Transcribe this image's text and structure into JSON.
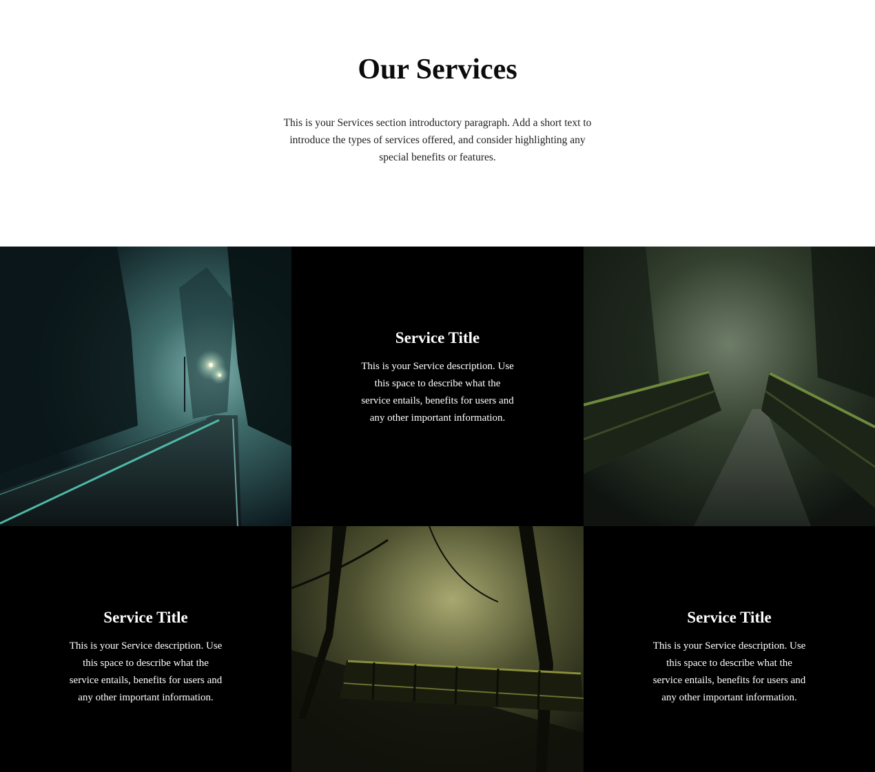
{
  "intro": {
    "title": "Our Services",
    "paragraph": "This is your Services section introductory paragraph. Add a short text to introduce the types of services offered, and consider highlighting any special benefits or features."
  },
  "services": [
    {
      "title": "Service Title",
      "description": "This is your Service description. Use this space to describe what the service entails, benefits for users and any other important information."
    },
    {
      "title": "Service Title",
      "description": "This is your Service description. Use this space to describe what the service entails, benefits for users and any other important information."
    },
    {
      "title": "Service Title",
      "description": "This is your Service description. Use this space to describe what the service entails, benefits for users and any other important information."
    }
  ],
  "images": [
    {
      "name": "misty-forest-road-image"
    },
    {
      "name": "forest-footbridge-image"
    },
    {
      "name": "swamp-bridge-image"
    }
  ],
  "colors": {
    "background": "#ffffff",
    "tile": "#000000",
    "heading_text": "#0b0b0b",
    "tile_text": "#ffffff"
  }
}
